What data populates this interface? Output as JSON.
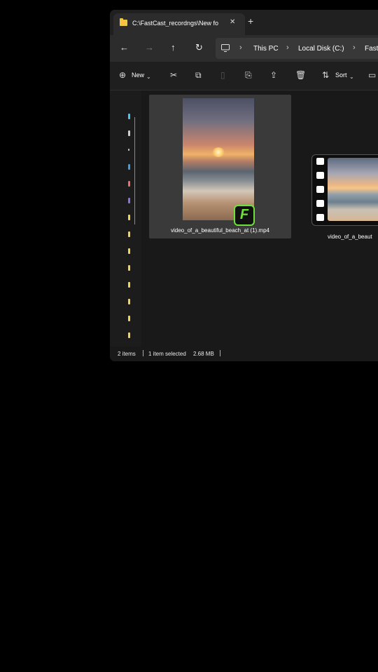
{
  "window": {
    "tab": {
      "title": "C:\\FastCast_recordngs\\New fo",
      "close_icon": "close-icon"
    },
    "new_tab_icon": "plus-icon",
    "nav": {
      "back_icon": "arrow-left-icon",
      "forward_icon": "arrow-right-icon",
      "up_icon": "arrow-up-icon",
      "refresh_icon": "refresh-icon"
    },
    "breadcrumbs": [
      "This PC",
      "Local Disk (C:)",
      "Fast"
    ],
    "command_bar": {
      "new_label": "New",
      "sort_label": "Sort"
    },
    "files": [
      {
        "name": "video_of_a_beautiful_beach_at (1).mp4",
        "selected": true
      },
      {
        "name": "video_of_a_beaut"
      }
    ],
    "status": {
      "items": "2 items",
      "selected": "1 item selected",
      "size": "2.68 MB"
    },
    "colors": {
      "window_bg": "#191919",
      "selection": "#3a3a3a",
      "folder": "#f3c63f",
      "app_badge": "#6fe03a"
    }
  }
}
